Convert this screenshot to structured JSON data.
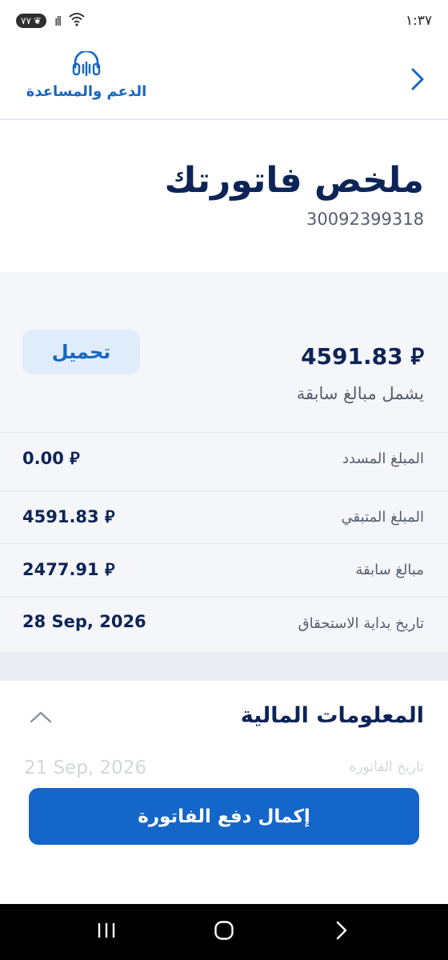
{
  "status_bar": {
    "battery": "٧٧",
    "signal": "ıll",
    "wifi": "◠",
    "time": "١:٣٧"
  },
  "header": {
    "support_label": "الدعم والمساعدة",
    "support_icon": "headset-icon",
    "back_icon": "chevron-right-icon"
  },
  "title_section": {
    "title": "ملخص فاتورتك",
    "account_number": "30092399318"
  },
  "summary": {
    "amount": "4591.83 ⃁",
    "download_label": "تحميل",
    "includes_note": "يشمل مبالغ سابقة",
    "rows": [
      {
        "label": "المبلغ المسدد",
        "value": "0.00 ⃁"
      },
      {
        "label": "المبلغ المتبقي",
        "value": "4591.83 ⃁"
      },
      {
        "label": "مبالغ سابقة",
        "value": "2477.91 ⃁"
      },
      {
        "label": "تاريخ بداية الاستحقاق",
        "value": "28 Sep, 2026"
      }
    ]
  },
  "financial_info": {
    "title": "المعلومات المالية",
    "faded_label": "تاريخ الفاتورة",
    "faded_value": "21 Sep, 2026"
  },
  "pay_button": {
    "label": "إكمال دفع الفاتورة"
  },
  "colors": {
    "primary": "#1467c9",
    "navy": "#0d2457",
    "muted": "#555e6e",
    "light_bg": "#f5f6f9",
    "button_light": "#e1ecfb"
  }
}
